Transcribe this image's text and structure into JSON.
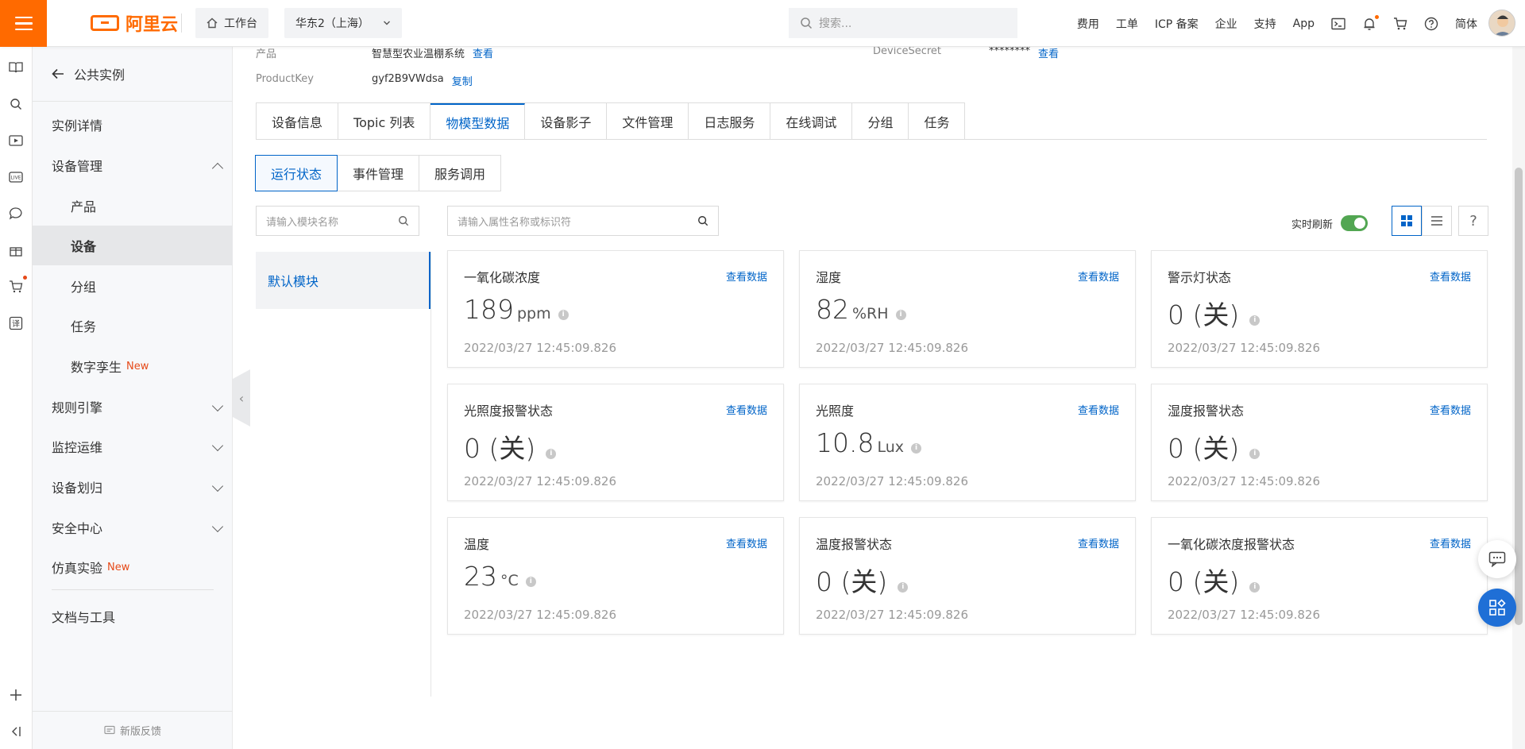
{
  "topbar": {
    "logo_text": "阿里云",
    "workbench": "工作台",
    "region": "华东2（上海）",
    "search_placeholder": "搜索...",
    "links": [
      "费用",
      "工单",
      "ICP 备案",
      "企业",
      "支持",
      "App"
    ],
    "language": "简体"
  },
  "sidebar": {
    "back_label": "公共实例",
    "items": [
      {
        "label": "实例详情"
      },
      {
        "label": "设备管理"
      },
      {
        "label": "产品"
      },
      {
        "label": "设备"
      },
      {
        "label": "分组"
      },
      {
        "label": "任务"
      },
      {
        "label": "数字孪生",
        "tag": "New"
      },
      {
        "label": "规则引擎"
      },
      {
        "label": "监控运维"
      },
      {
        "label": "设备划归"
      },
      {
        "label": "安全中心"
      },
      {
        "label": "仿真实验",
        "tag": "New"
      },
      {
        "label": "文档与工具"
      }
    ],
    "feedback": "新版反馈"
  },
  "device_info": {
    "product_label": "产品",
    "product_value": "智慧型农业温棚系统",
    "product_link": "查看",
    "productkey_label": "ProductKey",
    "productkey_value": "gyf2B9VWdsa",
    "productkey_link": "复制",
    "secret_label": "DeviceSecret",
    "secret_value": "********",
    "secret_link": "查看"
  },
  "tabs_primary": [
    "设备信息",
    "Topic 列表",
    "物模型数据",
    "设备影子",
    "文件管理",
    "日志服务",
    "在线调试",
    "分组",
    "任务"
  ],
  "tabs_secondary": [
    "运行状态",
    "事件管理",
    "服务调用"
  ],
  "module_search_placeholder": "请输入模块名称",
  "property_search_placeholder": "请输入属性名称或标识符",
  "module_default": "默认模块",
  "realtime_refresh_label": "实时刷新",
  "card_link_label": "查看数据",
  "cards": [
    {
      "title": "一氧化碳浓度",
      "value": "189",
      "unit": "ppm",
      "time": "2022/03/27 12:45:09.826"
    },
    {
      "title": "湿度",
      "value": "82",
      "unit": "%RH",
      "time": "2022/03/27 12:45:09.826"
    },
    {
      "title": "警示灯状态",
      "value": "0 (关)",
      "unit": "",
      "time": "2022/03/27 12:45:09.826"
    },
    {
      "title": "光照度报警状态",
      "value": "0 (关)",
      "unit": "",
      "time": "2022/03/27 12:45:09.826"
    },
    {
      "title": "光照度",
      "value": "10.8",
      "unit": "Lux",
      "time": "2022/03/27 12:45:09.826"
    },
    {
      "title": "湿度报警状态",
      "value": "0 (关)",
      "unit": "",
      "time": "2022/03/27 12:45:09.826"
    },
    {
      "title": "温度",
      "value": "23",
      "unit": "°C",
      "time": "2022/03/27 12:45:09.826"
    },
    {
      "title": "温度报警状态",
      "value": "0 (关)",
      "unit": "",
      "time": "2022/03/27 12:45:09.826"
    },
    {
      "title": "一氧化碳浓度报警状态",
      "value": "0 (关)",
      "unit": "",
      "time": "2022/03/27 12:45:09.826"
    }
  ],
  "colors": {
    "brand": "#ff6a00",
    "link": "#0064c8",
    "toggle_on": "#52a652"
  }
}
